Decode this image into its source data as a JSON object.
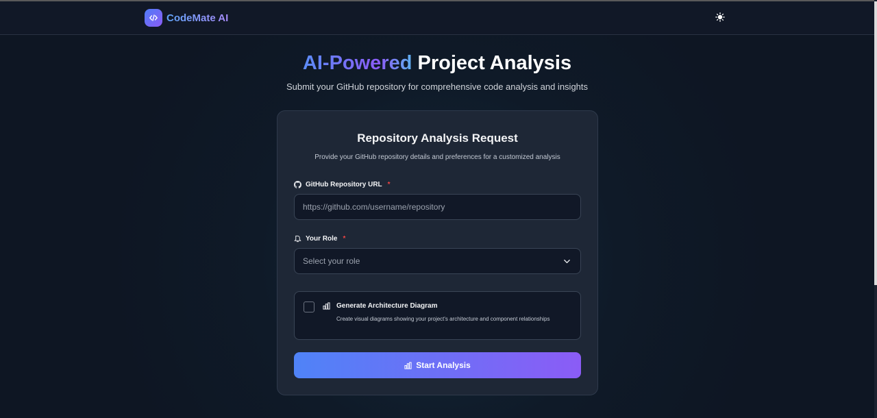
{
  "brand": {
    "name": "CodeMate AI",
    "logo_icon": "code-logo-icon"
  },
  "header": {
    "theme_toggle_icon": "sun-icon"
  },
  "hero": {
    "title_highlight": "AI-Powered",
    "title_rest": "Project Analysis",
    "subtitle": "Submit your GitHub repository for comprehensive code analysis and insights"
  },
  "card": {
    "title": "Repository Analysis Request",
    "subtitle": "Provide your GitHub repository details and preferences for a customized analysis"
  },
  "form": {
    "repo_url": {
      "label": "GitHub Repository URL",
      "required_mark": "*",
      "icon": "github-icon",
      "value": "",
      "placeholder": "https://github.com/username/repository"
    },
    "role": {
      "label": "Your Role",
      "required_mark": "*",
      "icon": "user-icon",
      "selected": "Select your role"
    },
    "architecture_option": {
      "title": "Generate Architecture Diagram",
      "description": "Create visual diagrams showing your project's architecture and component relationships",
      "checked": false,
      "icon": "bar-chart-icon"
    },
    "submit": {
      "label": "Start Analysis",
      "icon": "bar-chart-icon"
    }
  },
  "colors": {
    "accent_blue": "#4f83f7",
    "accent_purple": "#8b5cf6",
    "required": "#ef4444",
    "background": "#0f1a28",
    "card": "#1e2736"
  }
}
